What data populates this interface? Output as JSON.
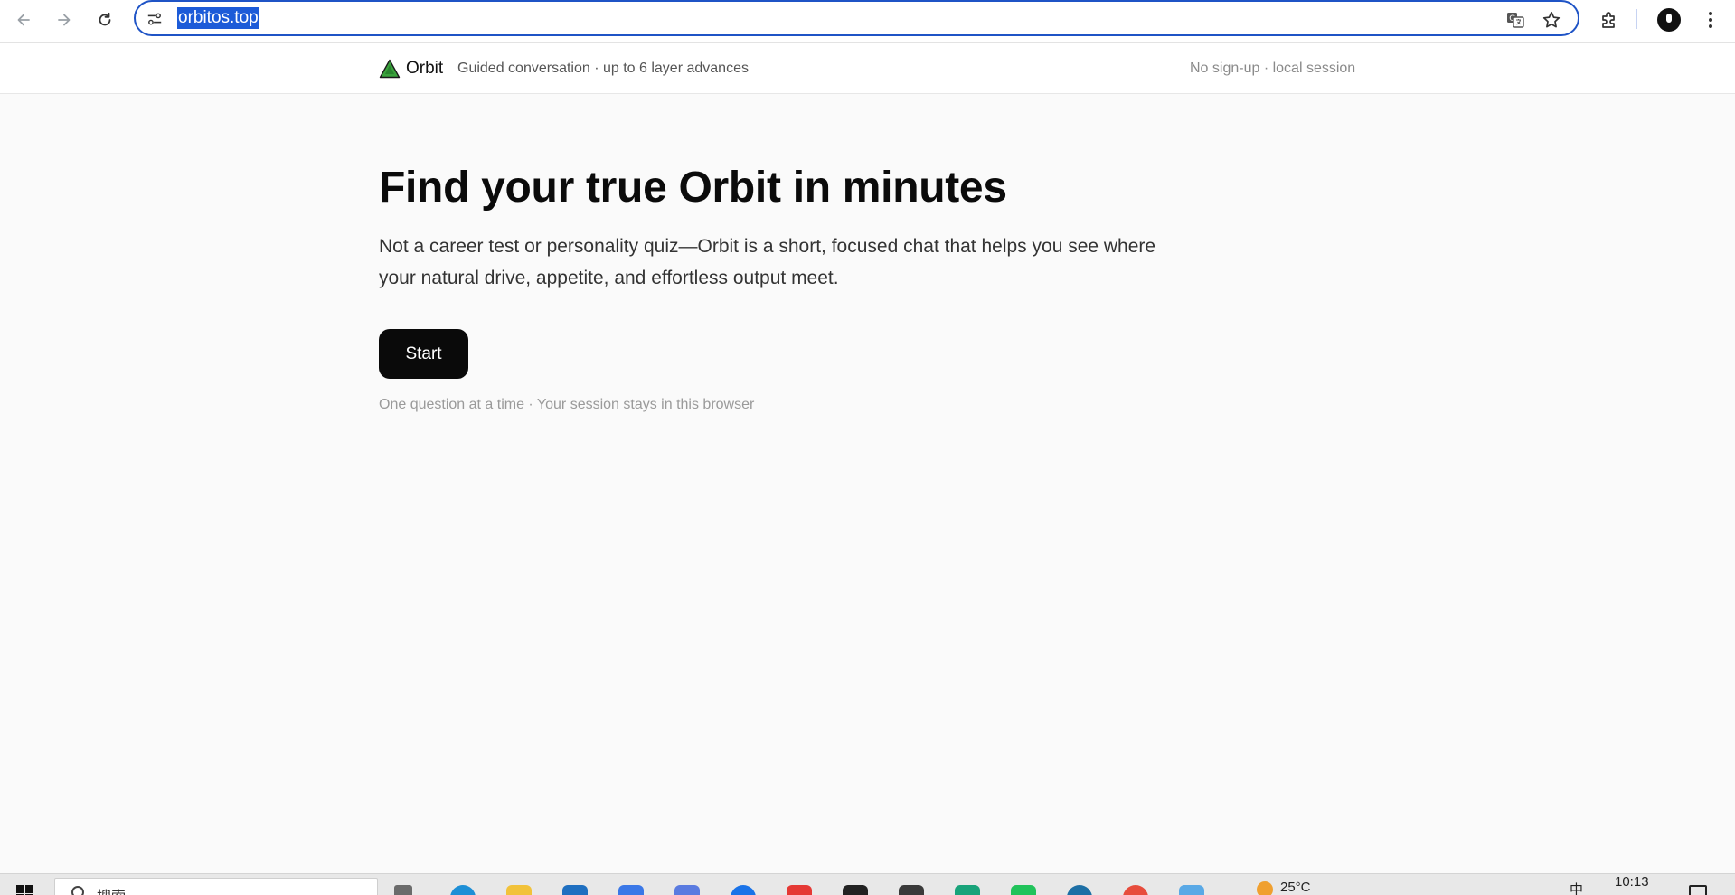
{
  "browser": {
    "url": "orbitos.top"
  },
  "site": {
    "brand": "Orbit",
    "tagline": "Guided conversation · up to 6 layer advances",
    "session_note": "No sign-up · local session"
  },
  "hero": {
    "title": "Find your true Orbit in minutes",
    "subtitle": "Not a career test or personality quiz—Orbit is a short, focused chat that helps you see where your natural drive, appetite, and effortless output meet.",
    "start_label": "Start",
    "footnote": "One question at a time · Your session stays in this browser"
  },
  "taskbar": {
    "search_text": "搜索",
    "temperature": "25°C",
    "ime": "中",
    "time": "10:13"
  },
  "colors": {
    "accent": "#1f54c6",
    "url_selection": "#1c5bd8",
    "button": "#0a0a0a",
    "page_bg": "#fafafa",
    "logo_green": "#3aa23c"
  },
  "icons": [
    "back-arrow-icon",
    "forward-arrow-icon",
    "reload-icon",
    "site-settings-icon",
    "translate-icon",
    "star-icon",
    "extensions-icon",
    "profile-avatar-icon",
    "more-menu-icon",
    "orbit-logo-icon"
  ]
}
